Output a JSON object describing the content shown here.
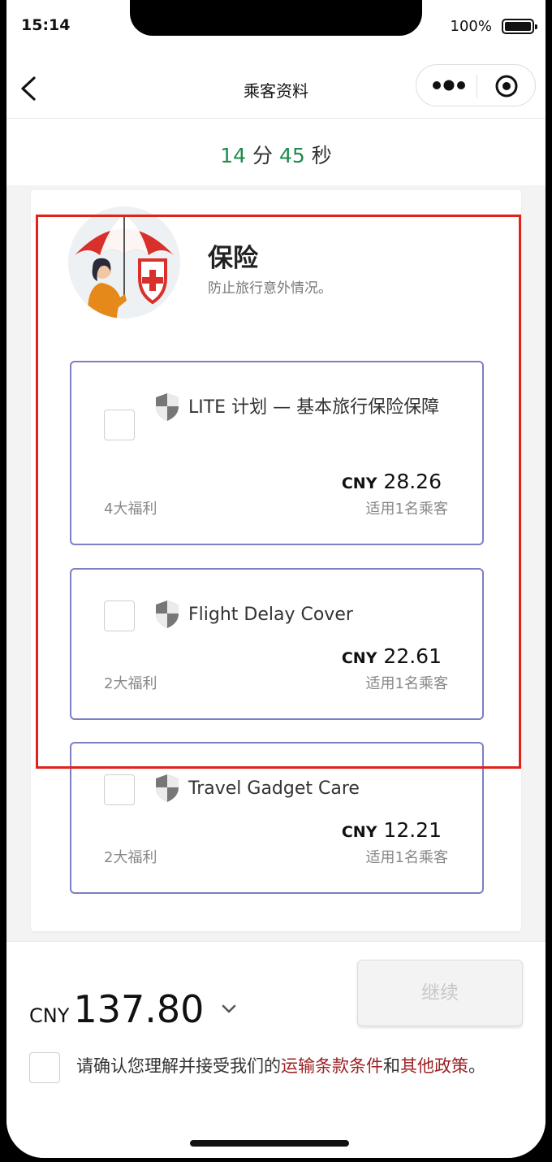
{
  "status": {
    "time": "15:14",
    "battery": "100%"
  },
  "nav": {
    "title": "乘客资料"
  },
  "timer": {
    "minutes": "14",
    "min_unit": "分",
    "seconds": "45",
    "sec_unit": "秒"
  },
  "insurance": {
    "title": "保险",
    "subtitle": "防止旅行意外情况。",
    "plans": [
      {
        "name": "LITE 计划 — 基本旅行保险保障",
        "currency": "CNY",
        "price": "28.26",
        "benefits": "4大福利",
        "per": "适用1名乘客"
      },
      {
        "name": "Flight Delay Cover",
        "currency": "CNY",
        "price": "22.61",
        "benefits": "2大福利",
        "per": "适用1名乘客"
      },
      {
        "name": "Travel Gadget Care",
        "currency": "CNY",
        "price": "12.21",
        "benefits": "2大福利",
        "per": "适用1名乘客"
      }
    ]
  },
  "footer": {
    "currency": "CNY",
    "total": "137.80",
    "continue": "继续",
    "terms_prefix": "请确认您理解并接受我们的",
    "terms_link1": "运输条款条件",
    "terms_and": "和",
    "terms_link2": "其他政策",
    "terms_suffix": "。"
  },
  "colors": {
    "accent_green": "#1f8a4c",
    "plan_border": "#7b7fc4",
    "highlight": "#e0231a",
    "link": "#9b2224"
  }
}
